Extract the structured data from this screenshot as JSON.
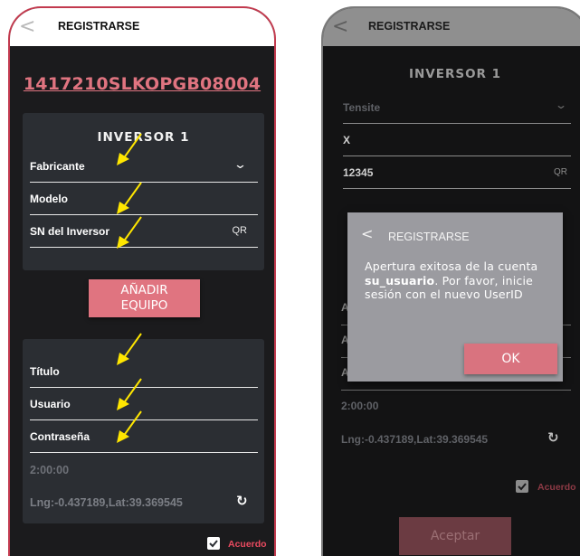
{
  "left": {
    "appbar": {
      "back_glyph": "<",
      "title": "REGISTRARSE"
    },
    "code": "1417210SLKOPGB08004",
    "inverter_card": {
      "title": "INVERSOR 1",
      "fields": [
        {
          "label": "Fabricante",
          "trailing": "dropdown"
        },
        {
          "label": "Modelo",
          "trailing": ""
        },
        {
          "label": "SN del Inversor",
          "trailing": "QR"
        }
      ]
    },
    "add_button": "AÑADIR\nEQUIPO",
    "account_card": {
      "fields": [
        {
          "label": "Título"
        },
        {
          "label": "Usuario"
        },
        {
          "label": "Contraseña"
        }
      ],
      "time": "2:00:00",
      "location": "Lng:-0.437189,Lat:39.369545"
    },
    "agreement_label": "Acuerdo",
    "annotation_arrow_color": "#ffe600"
  },
  "right": {
    "appbar": {
      "back_glyph": "<",
      "title": "REGISTRARSE"
    },
    "inverter": {
      "title": "INVERSOR 1",
      "fields": [
        {
          "value": "Tensite",
          "trailing": "dropdown"
        },
        {
          "value": "X",
          "trailing": ""
        },
        {
          "value": "12345",
          "trailing": "QR"
        }
      ]
    },
    "behind_stub_letter": "A",
    "time": "2:00:00",
    "location": "Lng:-0.437189,Lat:39.369545",
    "agreement_label": "Acuerdo",
    "dialog": {
      "back_glyph": "<",
      "title": "REGISTRARSE",
      "message_pre": "Apertura exitosa de la cuenta ",
      "message_user": "su_usuario",
      "message_post": ". Por favor, inicie sesión con el nuevo UserID",
      "ok_label": "OK"
    },
    "accept_button": "Aceptar"
  },
  "colors": {
    "accent": "#e07480",
    "frame_left": "#c23a4e",
    "card_bg": "#2b2e33",
    "screen_bg": "#1b1b1d"
  }
}
